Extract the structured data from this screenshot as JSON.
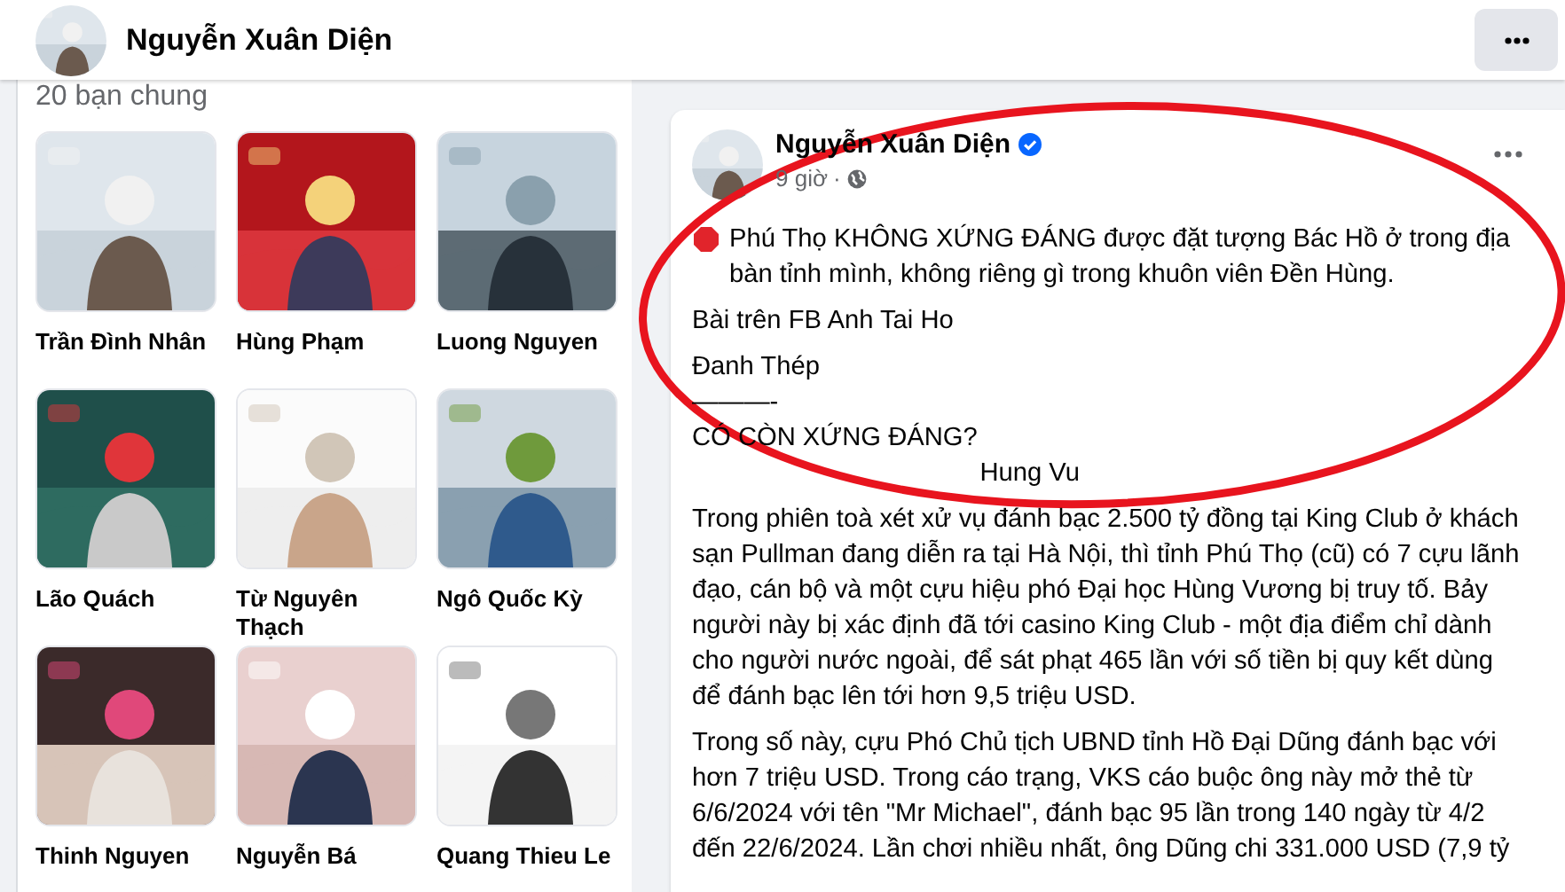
{
  "header": {
    "name": "Nguyễn Xuân Diện"
  },
  "friends": {
    "count_label": "20 bạn chung",
    "items": [
      {
        "name": "Trần Đình Nhân"
      },
      {
        "name": "Hùng Phạm"
      },
      {
        "name": "Luong Nguyen"
      },
      {
        "name": "Lão Quách"
      },
      {
        "name": "Từ Nguyên Thạch"
      },
      {
        "name": "Ngô Quốc Kỳ"
      },
      {
        "name": "Thinh Nguyen"
      },
      {
        "name": "Nguyễn Bá"
      },
      {
        "name": "Quang Thieu Le"
      }
    ]
  },
  "post": {
    "author": "Nguyễn Xuân Diện",
    "verified": true,
    "time": "9 giờ",
    "time_separator": "·",
    "paragraphs": [
      {
        "kind": "alert",
        "text": "Phú Thọ KHÔNG XỨNG ĐÁNG được đặt tượng Bác Hồ ở trong địa bàn tỉnh mình, không riêng gì trong khuôn viên Đền Hùng."
      },
      {
        "kind": "text",
        "text": "Bài trên FB Anh Tai Ho"
      },
      {
        "kind": "text",
        "text": "Đanh Thép\n———-\nCÓ CÒN XỨNG ĐÁNG?\n                                        Hung Vu"
      },
      {
        "kind": "text",
        "text": "Trong phiên toà xét xử vụ đánh bạc 2.500 tỷ đồng tại King Club ở khách sạn Pullman đang diễn ra tại Hà Nội, thì tỉnh Phú Thọ (cũ) có 7 cựu lãnh đạo, cán bộ và một cựu hiệu phó Đại học Hùng Vương bị truy tố. Bảy người này bị xác định đã tới casino King Club - một địa điểm chỉ dành cho người nước ngoài, để sát phạt 465 lần với số tiền bị quy kết dùng để đánh bạc lên tới hơn 9,5 triệu USD."
      },
      {
        "kind": "text",
        "text": "Trong số này, cựu Phó Chủ tịch UBND tỉnh Hồ Đại Dũng đánh bạc với hơn 7 triệu USD. Trong cáo trạng, VKS cáo buộc ông này mở thẻ từ 6/6/2024 với tên \"Mr Michael\", đánh bạc 95 lần trong 140 ngày từ 4/2 đến 22/6/2024. Lần chơi nhiều nhất, ông Dũng chi 331.000 USD (7,9 tỷ"
      }
    ]
  },
  "annotation": {
    "kind": "ellipse"
  }
}
